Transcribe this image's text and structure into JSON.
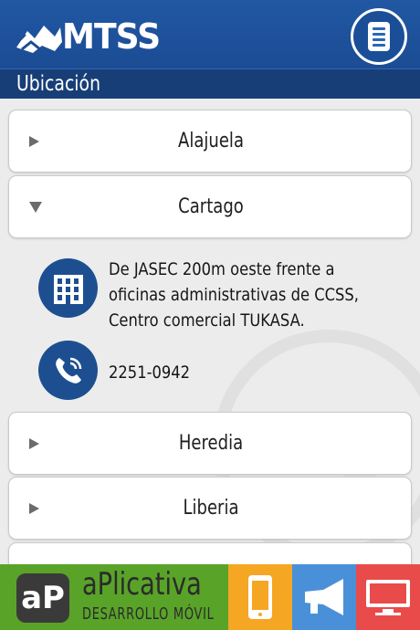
{
  "header": {
    "brand": "MTSS",
    "menu_icon": "document-list-icon"
  },
  "section": {
    "title": "Ubicación"
  },
  "accordion": {
    "items": [
      {
        "label": "Alajuela",
        "expanded": false
      },
      {
        "label": "Cartago",
        "expanded": true
      },
      {
        "label": "Heredia",
        "expanded": false
      },
      {
        "label": "Liberia",
        "expanded": false
      }
    ]
  },
  "detail": {
    "address": "De JASEC 200m oeste frente a oficinas administrativas de CCSS, Centro comercial TUKASA.",
    "address_icon": "building-icon",
    "phone": "2251-0942",
    "phone_icon": "phone-icon"
  },
  "ad": {
    "logo": "aP",
    "name": "aPlicativa",
    "tagline": "DESARROLLO MÓVIL",
    "tiles": [
      {
        "icon": "mobile-icon",
        "color": "#f5a623"
      },
      {
        "icon": "megaphone-icon",
        "color": "#4a90d9"
      },
      {
        "icon": "monitor-icon",
        "color": "#e94b4b"
      }
    ]
  },
  "colors": {
    "primary": "#1b4c93",
    "dark": "#173e76",
    "ad_green": "#59a329"
  }
}
